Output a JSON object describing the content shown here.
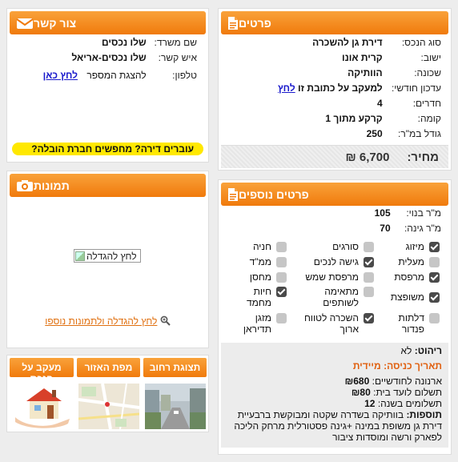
{
  "details": {
    "title": "פרטים",
    "rows": [
      {
        "label": "סוג הנכס:",
        "value": "דירת גן להשכרה"
      },
      {
        "label": "ישוב:",
        "value": "קרית אונו"
      },
      {
        "label": "שכונה:",
        "value": "הוותיקה"
      },
      {
        "label": "עדכון חודשי:",
        "value": "למעקב על כתובת זו",
        "link": "לחץ"
      },
      {
        "label": "חדרים:",
        "value": "4"
      },
      {
        "label": "קומה:",
        "value": "קרקע מתוך 1"
      },
      {
        "label": "גודל במ\"ר:",
        "value": "250"
      }
    ],
    "price_label": "מחיר:",
    "price_value": "₪ 6,700"
  },
  "contact": {
    "title": "צור קשר",
    "office_label": "שם משרד:",
    "office_value": "שלו נכסים",
    "person_label": "איש קשר:",
    "person_value": "שלו נכסים-אריאל",
    "phone_label": "טלפון:",
    "phone_text": "להצגת המספר",
    "phone_link": "לחץ כאן",
    "banner": "עוברים דירה? מחפשים חברת הובלה?"
  },
  "photos": {
    "title": "תמונות",
    "image_alt": "לחץ להגדלה",
    "more_link": "לחץ להגדלה ולתמונות נוספו"
  },
  "views": {
    "street": "תצוגת רחוב",
    "map": "מפת האזור",
    "track": "מעקב על הנכס"
  },
  "extra": {
    "title": "פרטים נוספים",
    "built_label": "מ\"ר בנוי:",
    "built_value": "105",
    "garden_label": "מ\"ר גינה:",
    "garden_value": "70",
    "features": [
      {
        "label": "מיזוג",
        "checked": true
      },
      {
        "label": "סורגים",
        "checked": false
      },
      {
        "label": "חניה",
        "checked": false
      },
      {
        "label": "מעלית",
        "checked": false
      },
      {
        "label": "גישה לנכים",
        "checked": true
      },
      {
        "label": "ממ\"ד",
        "checked": false
      },
      {
        "label": "מרפסת",
        "checked": true
      },
      {
        "label": "מרפסת שמש",
        "checked": false
      },
      {
        "label": "מחסן",
        "checked": false
      },
      {
        "label": "משופצת",
        "checked": true
      },
      {
        "label": "מתאימה לשותפים",
        "checked": false
      },
      {
        "label": "חיות מחמד",
        "checked": true
      },
      {
        "label": "דלתות פנדור",
        "checked": false
      },
      {
        "label": "השכרה לטווח ארוך",
        "checked": true
      },
      {
        "label": "מזגן תדיראן",
        "checked": false
      }
    ],
    "furniture_label": "ריהוט:",
    "furniture_value": "לא",
    "entry_label": "תאריך כניסה:",
    "entry_value": "מיידית",
    "arnona_label": "ארנונה לחודשיים:",
    "arnona_value": "₪680",
    "committee_label": "תשלום לועד בית:",
    "committee_value": "₪80",
    "payments_label": "תשלומים בשנה:",
    "payments_value": "12",
    "additions_label": "תוספות:",
    "additions_value": "בוותיקה בשדרה שקטה ומבוקשת ברבעיית דירת גן משופת במינה +גינה פסטורלית מרחק הליכה לפארק ורשה ומוסדות ציבור"
  },
  "colors": {
    "accent": "#f07a0c",
    "banner": "#ffe800",
    "link": "#1a1acc",
    "entry_date": "#e06010"
  }
}
